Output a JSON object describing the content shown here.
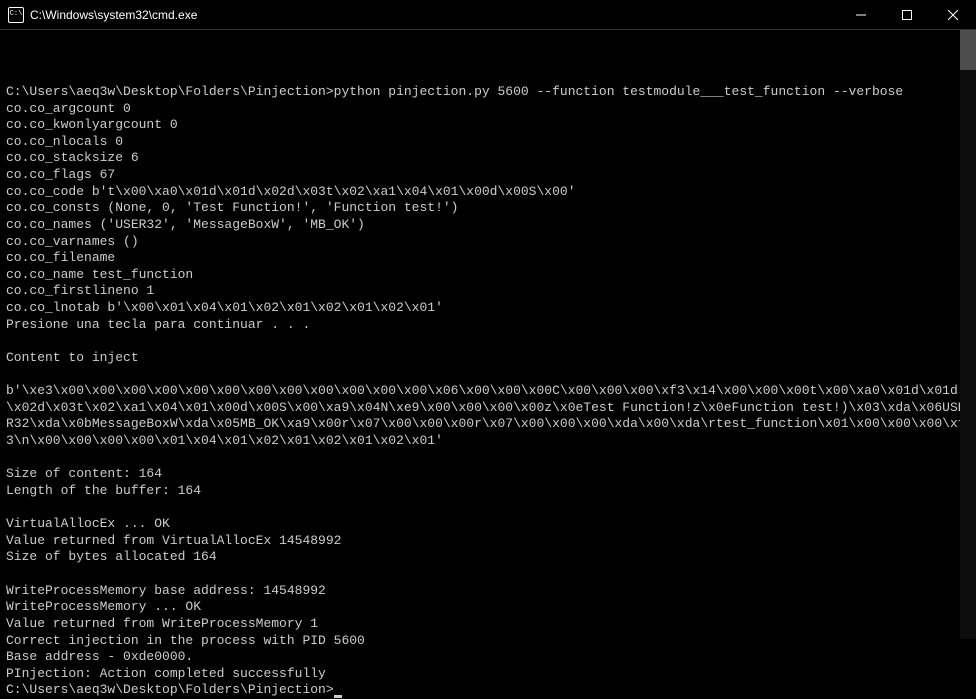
{
  "titlebar": {
    "icon_label": "C:\\",
    "title": "C:\\Windows\\system32\\cmd.exe"
  },
  "terminal": {
    "prompt1": "C:\\Users\\aeq3w\\Desktop\\Folders\\Pinjection>",
    "command": "python pinjection.py 5600 --function testmodule___test_function --verbose",
    "lines": [
      "co.co_argcount 0",
      "co.co_kwonlyargcount 0",
      "co.co_nlocals 0",
      "co.co_stacksize 6",
      "co.co_flags 67",
      "co.co_code b't\\x00\\xa0\\x01d\\x01d\\x02d\\x03t\\x02\\xa1\\x04\\x01\\x00d\\x00S\\x00'",
      "co.co_consts (None, 0, 'Test Function!', 'Function test!')",
      "co.co_names ('USER32', 'MessageBoxW', 'MB_OK')",
      "co.co_varnames ()",
      "co.co_filename",
      "co.co_name test_function",
      "co.co_firstlineno 1",
      "co.co_lnotab b'\\x00\\x01\\x04\\x01\\x02\\x01\\x02\\x01\\x02\\x01'",
      "Presione una tecla para continuar . . .",
      "",
      "Content to inject",
      "",
      "b'\\xe3\\x00\\x00\\x00\\x00\\x00\\x00\\x00\\x00\\x00\\x00\\x00\\x00\\x06\\x00\\x00\\x00C\\x00\\x00\\x00\\xf3\\x14\\x00\\x00\\x00t\\x00\\xa0\\x01d\\x01d\\x02d\\x03t\\x02\\xa1\\x04\\x01\\x00d\\x00S\\x00\\xa9\\x04N\\xe9\\x00\\x00\\x00\\x00z\\x0eTest Function!z\\x0eFunction test!)\\x03\\xda\\x06USER32\\xda\\x0bMessageBoxW\\xda\\x05MB_OK\\xa9\\x00r\\x07\\x00\\x00\\x00r\\x07\\x00\\x00\\x00\\xda\\x00\\xda\\rtest_function\\x01\\x00\\x00\\x00\\xf3\\n\\x00\\x00\\x00\\x00\\x01\\x04\\x01\\x02\\x01\\x02\\x01\\x02\\x01'",
      "",
      "Size of content: 164",
      "Length of the buffer: 164",
      "",
      "VirtualAllocEx ... OK",
      "Value returned from VirtualAllocEx 14548992",
      "Size of bytes allocated 164",
      "",
      "WriteProcessMemory base address: 14548992",
      "WriteProcessMemory ... OK",
      "Value returned from WriteProcessMemory 1",
      "Correct injection in the process with PID 5600",
      "Base address - 0xde0000.",
      "PInjection: Action completed successfully",
      ""
    ],
    "prompt2": "C:\\Users\\aeq3w\\Desktop\\Folders\\Pinjection>"
  }
}
